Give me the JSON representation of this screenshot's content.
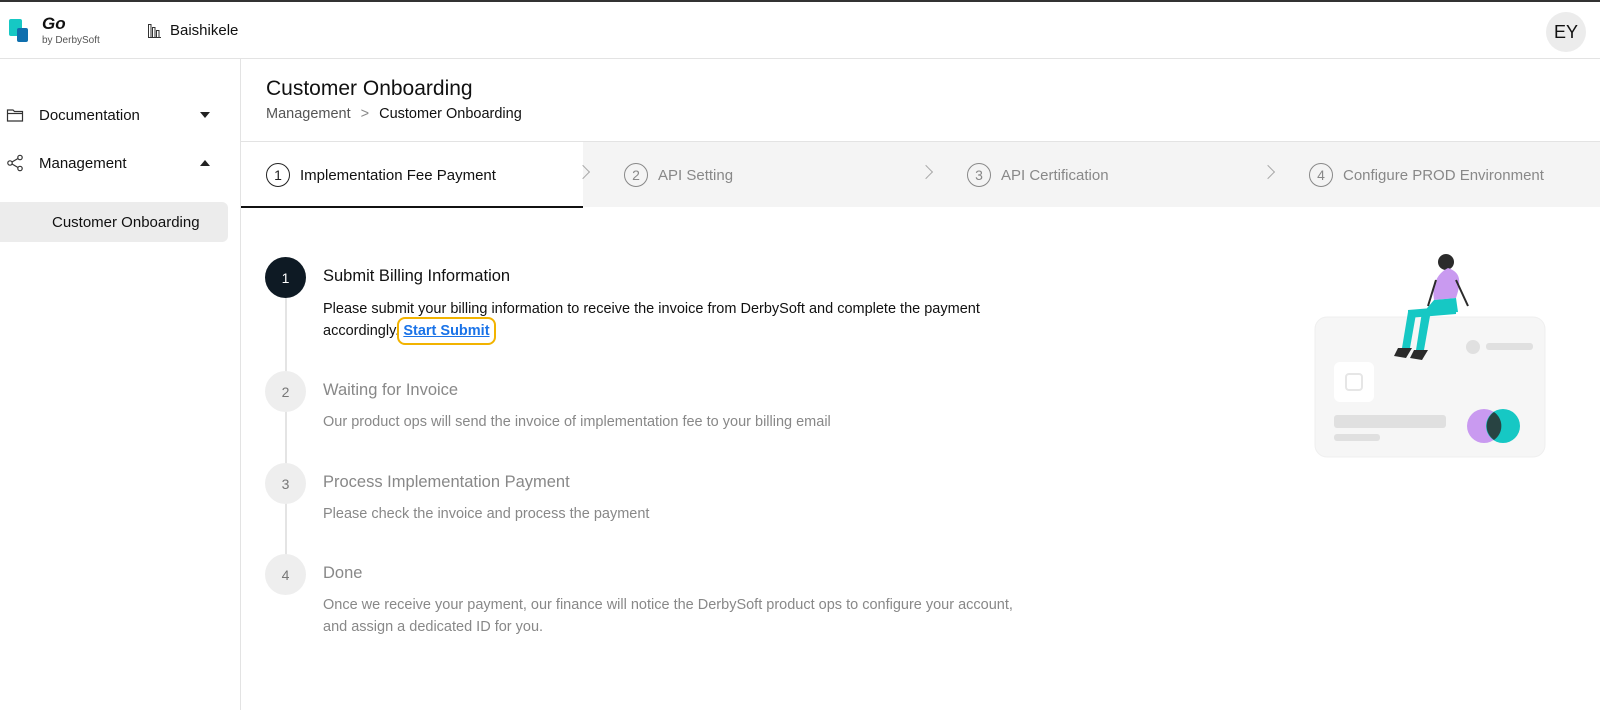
{
  "header": {
    "logo_title": "Go",
    "logo_subtitle": "by DerbySoft",
    "org_name": "Baishikele",
    "avatar_initials": "EY"
  },
  "sidebar": {
    "items": [
      {
        "label": "Documentation",
        "icon": "folder-icon",
        "expanded": false
      },
      {
        "label": "Management",
        "icon": "share-icon",
        "expanded": true
      }
    ],
    "sub_item": "Customer Onboarding"
  },
  "page": {
    "title": "Customer Onboarding",
    "breadcrumb": {
      "parent": "Management",
      "separator": ">",
      "current": "Customer Onboarding"
    }
  },
  "steps": [
    {
      "num": "1",
      "label": "Implementation Fee Payment",
      "active": true
    },
    {
      "num": "2",
      "label": "API Setting",
      "active": false
    },
    {
      "num": "3",
      "label": "API Certification",
      "active": false
    },
    {
      "num": "4",
      "label": "Configure PROD Environment",
      "active": false
    }
  ],
  "timeline": [
    {
      "num": "1",
      "title": "Submit Billing Information",
      "desc": "Please submit your billing information to receive the invoice from DerbySoft and complete the payment accordingly.",
      "link": "Start Submit",
      "active": true
    },
    {
      "num": "2",
      "title": "Waiting for Invoice",
      "desc": "Our product ops will send the invoice of implementation fee to your billing email",
      "active": false
    },
    {
      "num": "3",
      "title": "Process Implementation Payment",
      "desc": "Please check the invoice and process the payment",
      "active": false
    },
    {
      "num": "4",
      "title": "Done",
      "desc": "Once we receive your payment, our finance will notice the DerbySoft product ops to configure your account, and assign a dedicated ID for you.",
      "active": false
    }
  ],
  "colors": {
    "accent_teal": "#16c8c4",
    "link_blue": "#1a73e8",
    "highlight": "#f2b300",
    "active_dark": "#0e1a24"
  }
}
